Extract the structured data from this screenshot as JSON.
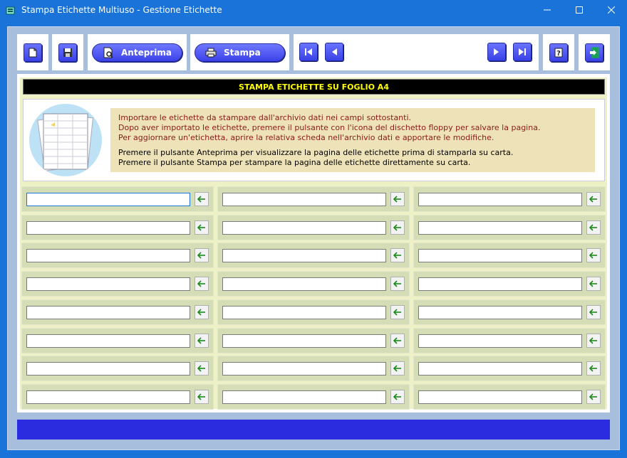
{
  "window": {
    "title": "Stampa Etichette Multiuso - Gestione Etichette"
  },
  "toolbar": {
    "preview_label": "Anteprima",
    "print_label": "Stampa"
  },
  "header": {
    "title": "STAMPA ETICHETTE SU FOGLIO A4"
  },
  "info": {
    "line1": "Importare le etichette da stampare dall'archivio dati nei campi sottostanti.",
    "line2": "Dopo aver importato le etichette, premere il pulsante con l'icona del dischetto floppy per salvare la pagina.",
    "line3": "Per aggiornare un'etichetta, aprire la relativa scheda nell'archivio dati e apportare le modifiche.",
    "line4": "Premere il pulsante Anteprima per visualizzare la pagina delle etichette prima di stamparla su carta.",
    "line5": "Premere il pulsante Stampa per stampare la pagina delle etichette direttamente su carta."
  },
  "grid": {
    "rows": 8,
    "columns": 3,
    "values": [
      "",
      "",
      "",
      "",
      "",
      "",
      "",
      "",
      "",
      "",
      "",
      "",
      "",
      "",
      "",
      "",
      "",
      "",
      "",
      "",
      "",
      "",
      "",
      ""
    ]
  },
  "colors": {
    "titlebar": "#1a73d9",
    "button": "#4a52f0",
    "status_bar": "#2b2be0",
    "header_text": "#ffff00",
    "info_red": "#8b1a1a"
  }
}
